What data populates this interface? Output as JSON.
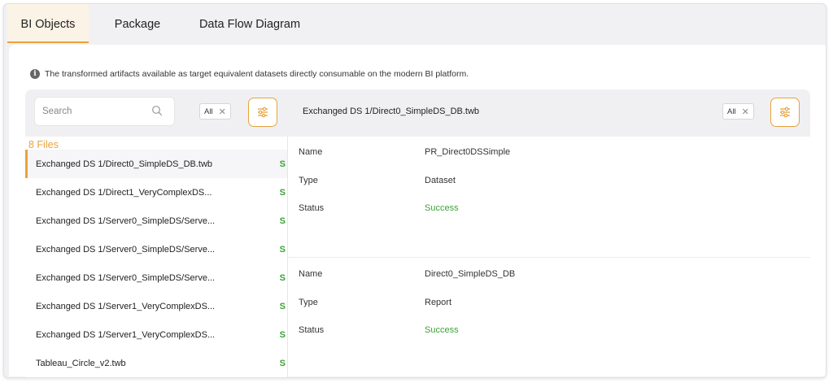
{
  "tabs": [
    {
      "label": "BI Objects",
      "active": true
    },
    {
      "label": "Package",
      "active": false
    },
    {
      "label": "Data Flow Diagram",
      "active": false
    }
  ],
  "info_text": "The transformed artifacts available as target equivalent datasets directly consumable on the modern BI platform.",
  "left_toolbar": {
    "search_placeholder": "Search",
    "filter_chip": "All"
  },
  "right_toolbar": {
    "title": "Exchanged DS 1/Direct0_SimpleDS_DB.twb",
    "filter_chip": "All"
  },
  "file_count": "8 Files",
  "files": [
    {
      "name": "Exchanged DS 1/Direct0_SimpleDS_DB.twb",
      "status": "S",
      "selected": true
    },
    {
      "name": "Exchanged DS 1/Direct1_VeryComplexDS...",
      "status": "S"
    },
    {
      "name": "Exchanged DS 1/Server0_SimpleDS/Serve...",
      "status": "S"
    },
    {
      "name": "Exchanged DS 1/Server0_SimpleDS/Serve...",
      "status": "S"
    },
    {
      "name": "Exchanged DS 1/Server0_SimpleDS/Serve...",
      "status": "S"
    },
    {
      "name": "Exchanged DS 1/Server1_VeryComplexDS...",
      "status": "S"
    },
    {
      "name": "Exchanged DS 1/Server1_VeryComplexDS...",
      "status": "S"
    },
    {
      "name": "Tableau_Circle_v2.twb",
      "status": "S"
    }
  ],
  "details": [
    {
      "name_label": "Name",
      "name_value": "PR_Direct0DSSimple",
      "type_label": "Type",
      "type_value": "Dataset",
      "status_label": "Status",
      "status_value": "Success"
    },
    {
      "name_label": "Name",
      "name_value": "Direct0_SimpleDS_DB",
      "type_label": "Type",
      "type_value": "Report",
      "status_label": "Status",
      "status_value": "Success"
    }
  ],
  "colors": {
    "accent": "#e8a33c",
    "success": "#3aa336"
  }
}
